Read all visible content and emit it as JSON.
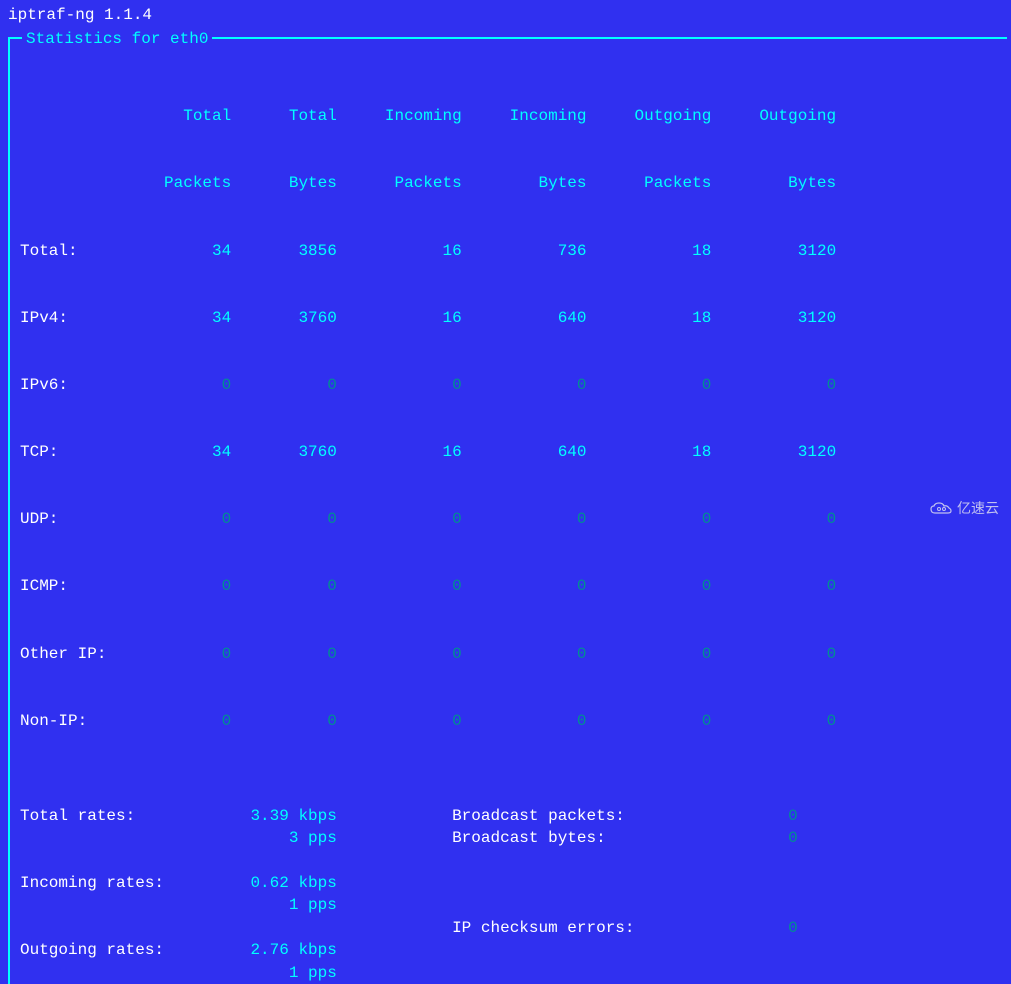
{
  "header": {
    "app_title": "iptraf-ng 1.1.4",
    "box_label": "Statistics for eth0"
  },
  "columns": {
    "c1a": "Total",
    "c1b": "Packets",
    "c2a": "Total",
    "c2b": "Bytes",
    "c3a": "Incoming",
    "c3b": "Packets",
    "c4a": "Incoming",
    "c4b": "Bytes",
    "c5a": "Outgoing",
    "c5b": "Packets",
    "c6a": "Outgoing",
    "c6b": "Bytes"
  },
  "rows": {
    "total": {
      "label": "Total:",
      "v": [
        "34",
        "3856",
        "16",
        "736",
        "18",
        "3120"
      ]
    },
    "ipv4": {
      "label": "IPv4:",
      "v": [
        "34",
        "3760",
        "16",
        "640",
        "18",
        "3120"
      ]
    },
    "ipv6": {
      "label": "IPv6:",
      "v": [
        "0",
        "0",
        "0",
        "0",
        "0",
        "0"
      ]
    },
    "tcp": {
      "label": "TCP:",
      "v": [
        "34",
        "3760",
        "16",
        "640",
        "18",
        "3120"
      ]
    },
    "udp": {
      "label": "UDP:",
      "v": [
        "0",
        "0",
        "0",
        "0",
        "0",
        "0"
      ]
    },
    "icmp": {
      "label": "ICMP:",
      "v": [
        "0",
        "0",
        "0",
        "0",
        "0",
        "0"
      ]
    },
    "otherip": {
      "label": "Other IP:",
      "v": [
        "0",
        "0",
        "0",
        "0",
        "0",
        "0"
      ]
    },
    "nonip": {
      "label": "Non-IP:",
      "v": [
        "0",
        "0",
        "0",
        "0",
        "0",
        "0"
      ]
    }
  },
  "rates": {
    "total_label": "Total rates:",
    "total_kbps": "3.39 kbps",
    "total_pps": "3 pps",
    "incoming_label": "Incoming rates:",
    "incoming_kbps": "0.62 kbps",
    "incoming_pps": "1 pps",
    "outgoing_label": "Outgoing rates:",
    "outgoing_kbps": "2.76 kbps",
    "outgoing_pps": "1 pps",
    "bcast_packets_label": "Broadcast packets:",
    "bcast_packets_val": "0",
    "bcast_bytes_label": "Broadcast bytes:",
    "bcast_bytes_val": "0",
    "ip_checksum_label": "IP checksum errors:",
    "ip_checksum_val": "0"
  },
  "watermark": {
    "text": "亿速云"
  },
  "chart_data": {
    "type": "table",
    "title": "Statistics for eth0",
    "columns": [
      "Total Packets",
      "Total Bytes",
      "Incoming Packets",
      "Incoming Bytes",
      "Outgoing Packets",
      "Outgoing Bytes"
    ],
    "rows": [
      {
        "name": "Total",
        "values": [
          34,
          3856,
          16,
          736,
          18,
          3120
        ]
      },
      {
        "name": "IPv4",
        "values": [
          34,
          3760,
          16,
          640,
          18,
          3120
        ]
      },
      {
        "name": "IPv6",
        "values": [
          0,
          0,
          0,
          0,
          0,
          0
        ]
      },
      {
        "name": "TCP",
        "values": [
          34,
          3760,
          16,
          640,
          18,
          3120
        ]
      },
      {
        "name": "UDP",
        "values": [
          0,
          0,
          0,
          0,
          0,
          0
        ]
      },
      {
        "name": "ICMP",
        "values": [
          0,
          0,
          0,
          0,
          0,
          0
        ]
      },
      {
        "name": "Other IP",
        "values": [
          0,
          0,
          0,
          0,
          0,
          0
        ]
      },
      {
        "name": "Non-IP",
        "values": [
          0,
          0,
          0,
          0,
          0,
          0
        ]
      }
    ],
    "rates": {
      "total_kbps": 3.39,
      "total_pps": 3,
      "incoming_kbps": 0.62,
      "incoming_pps": 1,
      "outgoing_kbps": 2.76,
      "outgoing_pps": 1
    },
    "broadcast_packets": 0,
    "broadcast_bytes": 0,
    "ip_checksum_errors": 0
  }
}
